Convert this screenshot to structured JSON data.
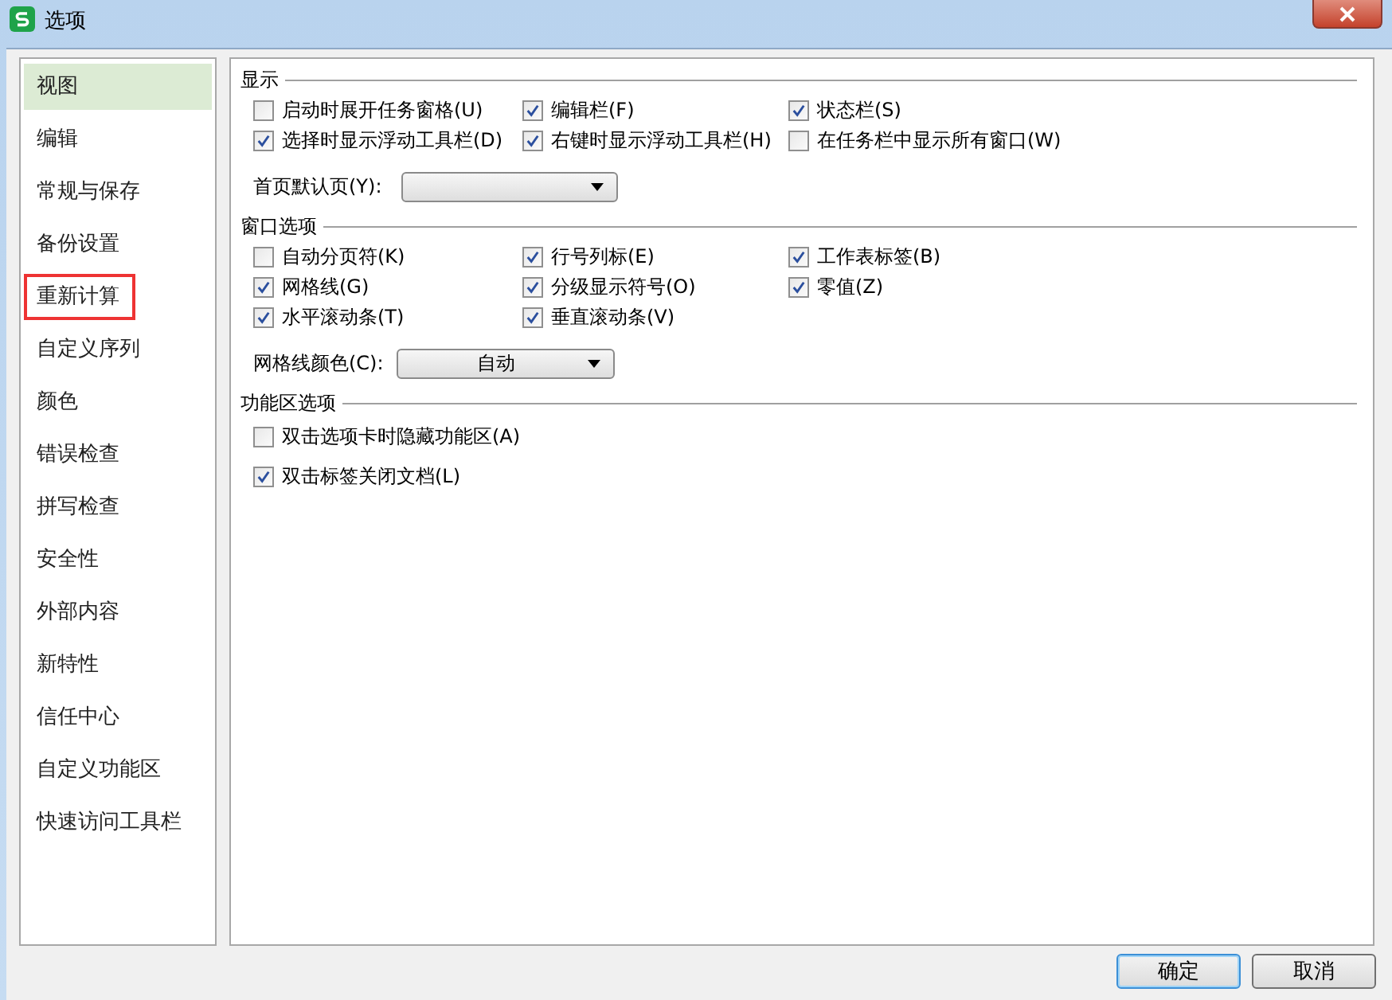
{
  "window": {
    "title": "选项"
  },
  "sidebar": {
    "items": [
      {
        "label": "视图",
        "selected": true,
        "highlighted": false
      },
      {
        "label": "编辑",
        "selected": false,
        "highlighted": false
      },
      {
        "label": "常规与保存",
        "selected": false,
        "highlighted": false
      },
      {
        "label": "备份设置",
        "selected": false,
        "highlighted": false
      },
      {
        "label": "重新计算",
        "selected": false,
        "highlighted": true
      },
      {
        "label": "自定义序列",
        "selected": false,
        "highlighted": false
      },
      {
        "label": "颜色",
        "selected": false,
        "highlighted": false
      },
      {
        "label": "错误检查",
        "selected": false,
        "highlighted": false
      },
      {
        "label": "拼写检查",
        "selected": false,
        "highlighted": false
      },
      {
        "label": "安全性",
        "selected": false,
        "highlighted": false
      },
      {
        "label": "外部内容",
        "selected": false,
        "highlighted": false
      },
      {
        "label": "新特性",
        "selected": false,
        "highlighted": false
      },
      {
        "label": "信任中心",
        "selected": false,
        "highlighted": false
      },
      {
        "label": "自定义功能区",
        "selected": false,
        "highlighted": false
      },
      {
        "label": "快速访问工具栏",
        "selected": false,
        "highlighted": false
      }
    ]
  },
  "sections": [
    {
      "title": "显示",
      "rows": [
        [
          {
            "label": "启动时展开任务窗格(U)",
            "checked": false
          },
          {
            "label": "编辑栏(F)",
            "checked": true
          },
          {
            "label": "状态栏(S)",
            "checked": true
          }
        ],
        [
          {
            "label": "选择时显示浮动工具栏(D)",
            "checked": true
          },
          {
            "label": "右键时显示浮动工具栏(H)",
            "checked": true
          },
          {
            "label": "在任务栏中显示所有窗口(W)",
            "checked": false
          }
        ]
      ],
      "dropdown": {
        "label": "首页默认页(Y):"
      }
    },
    {
      "title": "窗口选项",
      "rows": [
        [
          {
            "label": "自动分页符(K)",
            "checked": false
          },
          {
            "label": "行号列标(E)",
            "checked": true
          },
          {
            "label": "工作表标签(B)",
            "checked": true
          }
        ],
        [
          {
            "label": "网格线(G)",
            "checked": true
          },
          {
            "label": "分级显示符号(O)",
            "checked": true
          },
          {
            "label": "零值(Z)",
            "checked": true
          }
        ],
        [
          {
            "label": "水平滚动条(T)",
            "checked": true
          },
          {
            "label": "垂直滚动条(V)",
            "checked": true
          }
        ]
      ],
      "dropdown": {
        "label": "网格线颜色(C):",
        "value": "自动"
      }
    },
    {
      "title": "功能区选项",
      "rows": [
        [
          {
            "label": "双击选项卡时隐藏功能区(A)",
            "checked": false
          }
        ],
        [
          {
            "label": "双击标签关闭文档(L)",
            "checked": true
          }
        ]
      ]
    }
  ],
  "buttons": [
    "确定",
    "取消"
  ]
}
